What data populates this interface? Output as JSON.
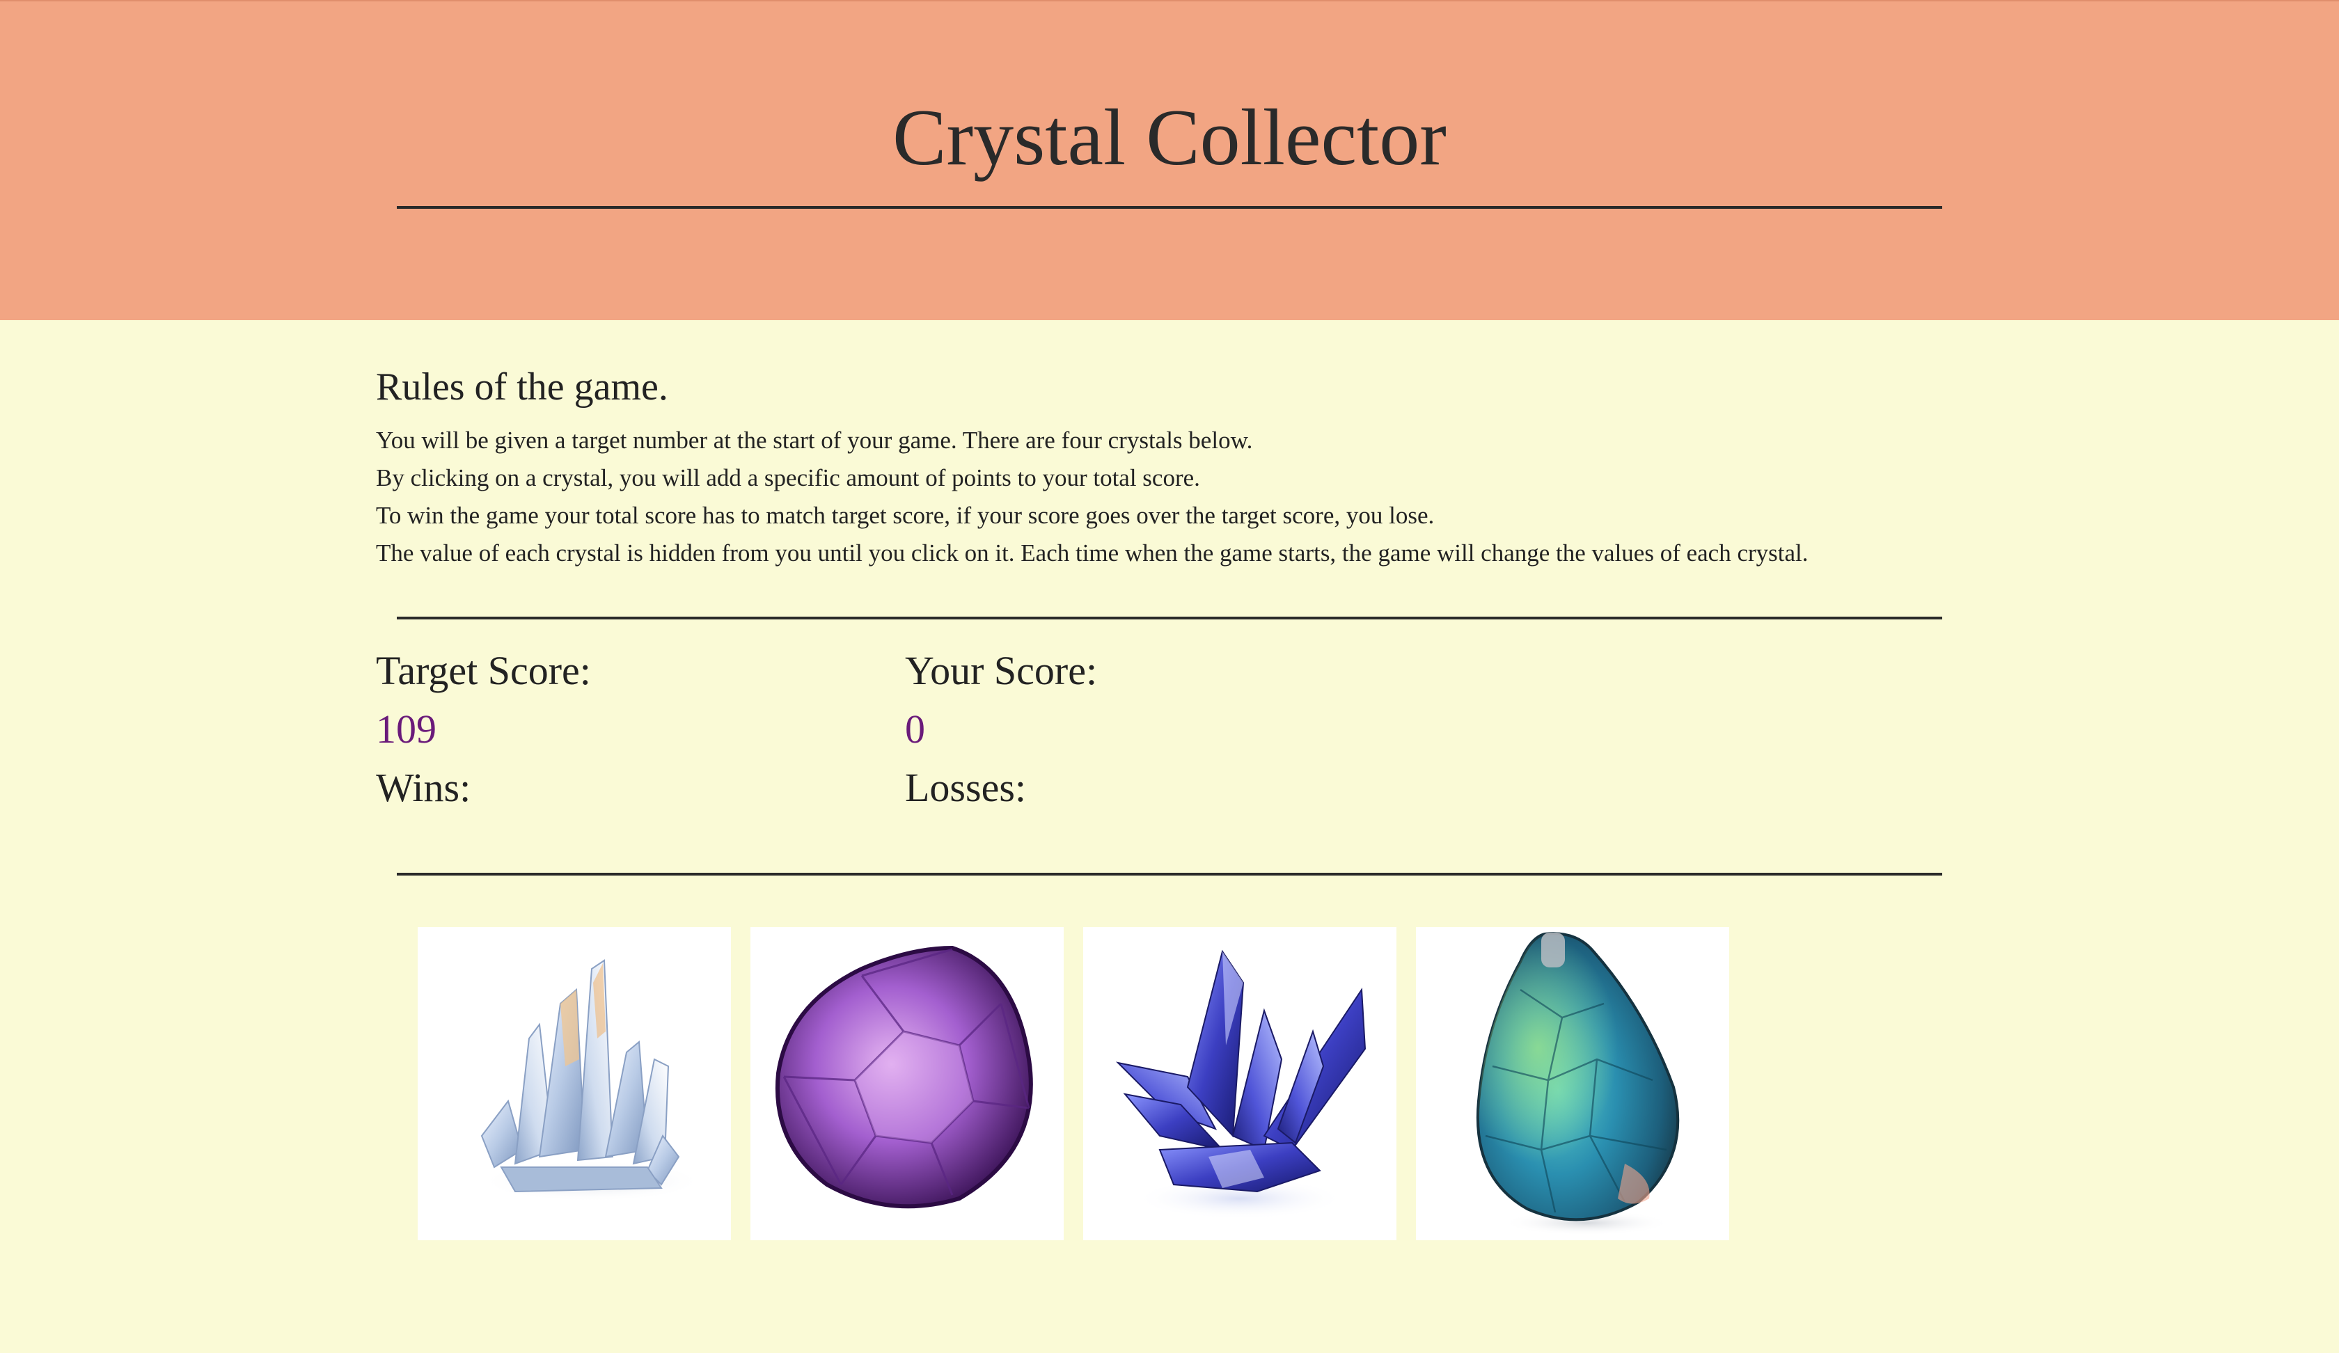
{
  "header": {
    "title": "Crystal Collector",
    "background_color": "#f2a583"
  },
  "rules": {
    "title": "Rules of the game.",
    "lines": [
      "You will be given a target number at the start of your game. There are four crystals below.",
      "By clicking on a crystal, you will add a specific amount of points to your total score.",
      "To win the game your total score has to match target score, if your score goes over the target score, you lose.",
      "The value of each crystal is hidden from you until you click on it. Each time when the game starts, the game will change the values of each crystal."
    ]
  },
  "scoreboard": {
    "target_label": "Target Score:",
    "target_value": "109",
    "your_label": "Your Score:",
    "your_value": "0",
    "wins_label": "Wins:",
    "wins_value": "",
    "losses_label": "Losses:",
    "losses_value": "",
    "value_color": "#6a1a7a"
  },
  "crystals": [
    {
      "icon": "clear-quartz-crystal-icon"
    },
    {
      "icon": "purple-amethyst-crystal-icon"
    },
    {
      "icon": "blue-tanzanite-crystal-icon"
    },
    {
      "icon": "teal-opal-drop-crystal-icon"
    }
  ],
  "colors": {
    "page_background": "#fafad6",
    "text": "#222222"
  }
}
